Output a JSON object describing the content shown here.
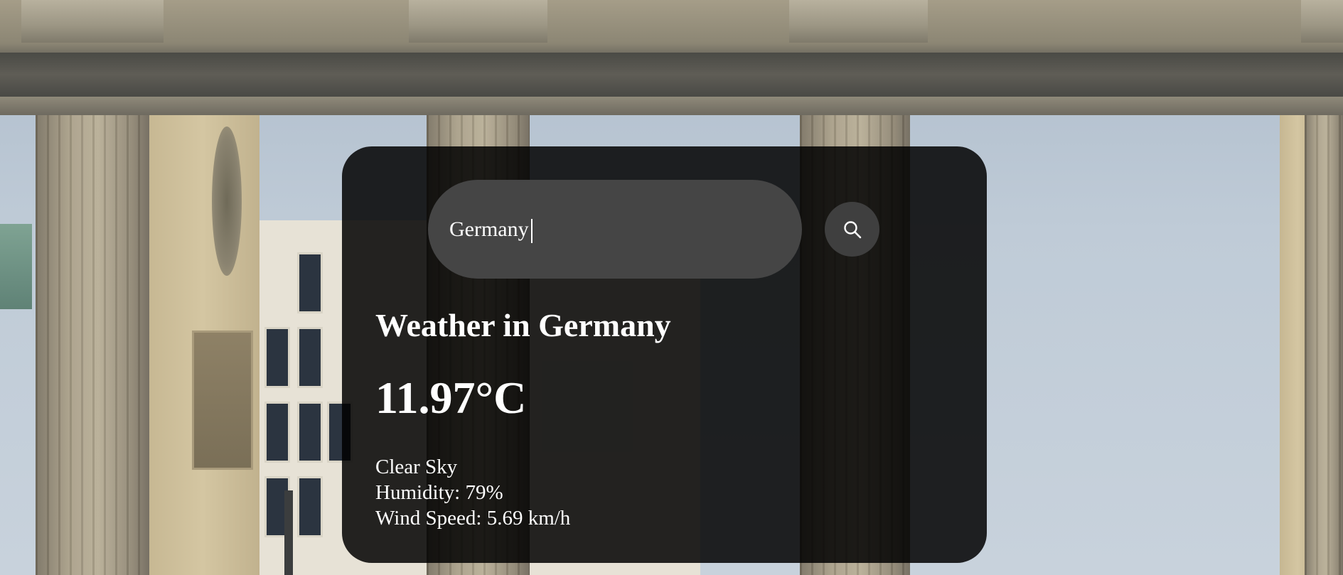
{
  "search": {
    "value": "Germany",
    "button_icon": "search-icon"
  },
  "weather": {
    "heading": "Weather in Germany",
    "temperature": "11.97°C",
    "description": "Clear Sky",
    "humidity": "Humidity: 79%",
    "wind": "Wind Speed: 5.69 km/h"
  },
  "colors": {
    "card_background": "#000000",
    "input_background": "#454545",
    "button_background": "#3f3f3f",
    "text": "#ffffff"
  }
}
